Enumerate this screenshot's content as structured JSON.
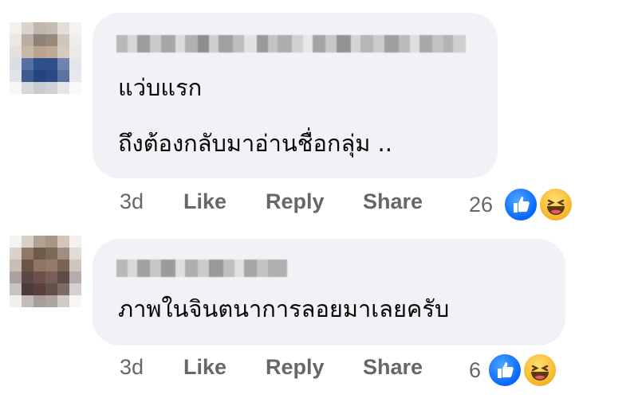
{
  "comments": [
    {
      "text_lines": [
        "แว่บแรก",
        "ถึงต้องกลับมาอ่านชื่อกลุ่ม .."
      ],
      "time": "3d",
      "actions": {
        "like": "Like",
        "reply": "Reply",
        "share": "Share"
      },
      "reaction_count": "26",
      "reaction_icons": [
        "like-icon",
        "haha-icon"
      ]
    },
    {
      "text_lines": [
        "ภาพในจินตนาการลอยมาเลยครับ"
      ],
      "time": "3d",
      "actions": {
        "like": "Like",
        "reply": "Reply",
        "share": "Share"
      },
      "reaction_count": "6",
      "reaction_icons": [
        "like-icon",
        "haha-icon"
      ]
    }
  ],
  "colors": {
    "bubble": "#f0f2f5",
    "action_text": "#65676b",
    "like_blue": "#0866ff",
    "haha_yellow": "#f7b125"
  }
}
